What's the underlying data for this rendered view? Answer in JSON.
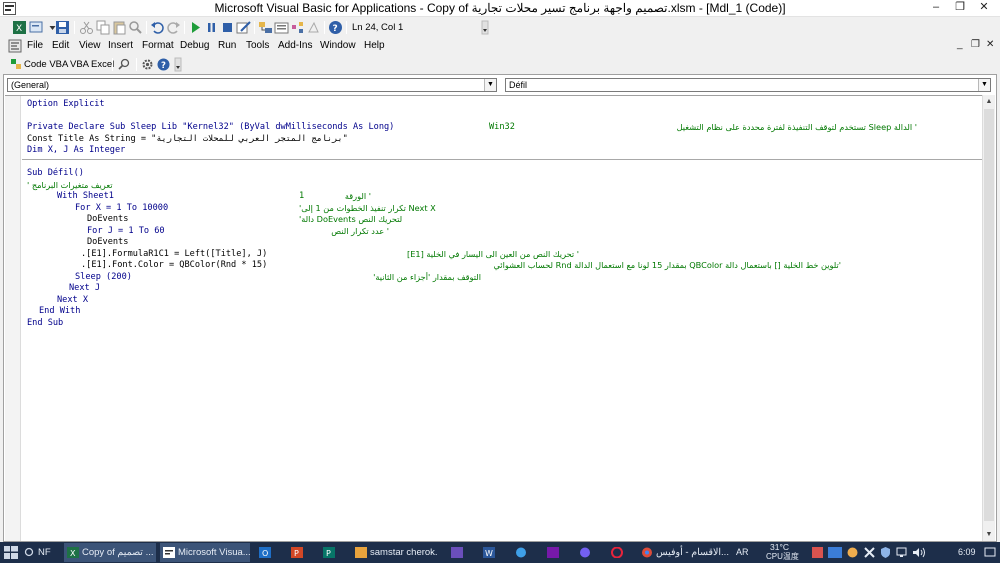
{
  "window": {
    "title": "Microsoft Visual Basic for Applications - Copy of تصميم واجهة برنامج تسير محلات تجارية.xlsm - [Mdl_1 (Code)]",
    "minimize": "–",
    "restore": "❐",
    "close": "✕",
    "mdi_minimize": "_",
    "mdi_restore": "❐",
    "mdi_close": "✕"
  },
  "toolbar": {
    "position": "Ln 24, Col 1"
  },
  "menu": {
    "items": [
      "File",
      "Edit",
      "View",
      "Insert",
      "Format",
      "Debug",
      "Run",
      "Tools",
      "Add-Ins",
      "Window",
      "Help"
    ]
  },
  "toolbar2": {
    "code_vba": "Code VBA",
    "vba": "VBA",
    "excel": "Excel"
  },
  "code_window": {
    "object_combo": "(General)",
    "proc_combo": "Défil"
  },
  "code": {
    "l1": "Option Explicit",
    "l2a": "Private Declare Sub Sleep Lib \"Kernel32\" (ByVal dwMilliseconds As Long)",
    "l2b": "Win32",
    "l2c": "' الدالة Sleep تستخدم لتوقف التنفيذة لفترة محددة على نظام التشغيل",
    "l3": "Const Title As String = \"برنامج المتجر العربي للمحلات التجارية\"",
    "l4": "Dim X, J As Integer",
    "l5": "Sub Défil()",
    "l6": "' تعريف متغيرات البرنامج",
    "l7a": "With Sheet1",
    "l7b": "1",
    "l7c": "' الورقة",
    "l8a": "For X = 1 To 10000",
    "l8b": "'تكرار تنفيذ الخطوات من 1 إلى Next X",
    "l9a": "DoEvents",
    "l9b": "'دالة DoEvents لتحريك النص",
    "l10a": "For J = 1 To 60",
    "l10b": "' عدد تكرار النص",
    "l11": "DoEvents",
    "l12a": ".[E1].FormulaR1C1 = Left([Title], J)",
    "l12b": "' تحريك النص من العين الى اليسار في الخلية [E1]",
    "l13a": ".[E1].Font.Color = QBColor(Rnd * 15)",
    "l13b": "'تلوين خط الخلية [] باستعمال دالة QBColor بمقدار 15 لونا مع استعمال الدالة Rnd لحساب العشوائي",
    "l14a": "Sleep (200)",
    "l14b": "التوقف بمقدار 'أجزاء من الثانية'",
    "l15": "Next J",
    "l16": "Next X",
    "l17": "End With",
    "l18": "End Sub"
  },
  "taskbar": {
    "tasks": [
      {
        "label": "NF"
      },
      {
        "label": "Copy of تصميم ..."
      },
      {
        "label": "Microsoft Visua..."
      },
      {
        "label": ""
      },
      {
        "label": ""
      },
      {
        "label": ""
      },
      {
        "label": "samstar cherok..."
      },
      {
        "label": ""
      },
      {
        "label": ""
      },
      {
        "label": ""
      },
      {
        "label": ""
      },
      {
        "label": ""
      },
      {
        "label": ""
      },
      {
        "label": "الاقسام - أوفيس..."
      }
    ],
    "lang": "AR",
    "temp": "31°C",
    "cpu": "CPU温度",
    "time": "6:09"
  },
  "colors": {
    "keyword": "#00008b",
    "comment": "#007800",
    "taskbar": "#1d2e4a"
  }
}
